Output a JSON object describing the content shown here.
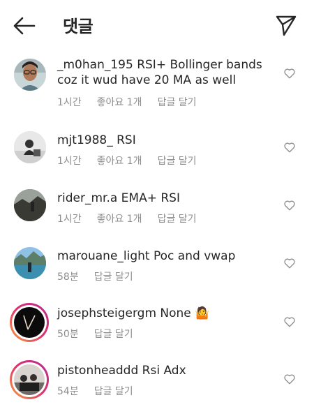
{
  "header": {
    "title": "댓글",
    "back_icon": "arrow-left-icon",
    "send_icon": "paper-plane-icon"
  },
  "comments": [
    {
      "username": "_m0han_195",
      "text": " RSI+ Bollinger bands coz it wud have 20 MA as well",
      "time": "1시간",
      "likes": "좋아요 1개",
      "reply": "답글 달기",
      "avatar": "man-with-glasses-photo"
    },
    {
      "username": "mjt1988_",
      "text": " RSI",
      "time": "1시간",
      "likes": "좋아요 1개",
      "reply": "답글 달기",
      "avatar": "bw-photo"
    },
    {
      "username": "rider_mr.a",
      "text": " EMA+ RSI",
      "time": "1시간",
      "likes": "좋아요 1개",
      "reply": "답글 달기",
      "avatar": "dark-landscape-photo"
    },
    {
      "username": "marouane_light",
      "text": " Poc and vwap",
      "time": "58분",
      "reply": "답글 달기",
      "avatar": "lake-mountains-photo"
    },
    {
      "username": "josephsteigergm",
      "text": " None 🤷",
      "time": "50분",
      "reply": "답글 달기",
      "avatar": "logo-black-photo"
    },
    {
      "username": "pistonheaddd",
      "text": " Rsi Adx",
      "time": "54분",
      "reply": "답글 달기",
      "avatar": "group-photo"
    }
  ],
  "colors": {
    "text": "#262626",
    "meta": "#8e8e8e",
    "story_ring_start": "#f9a33a",
    "story_ring_end": "#b12e94"
  }
}
